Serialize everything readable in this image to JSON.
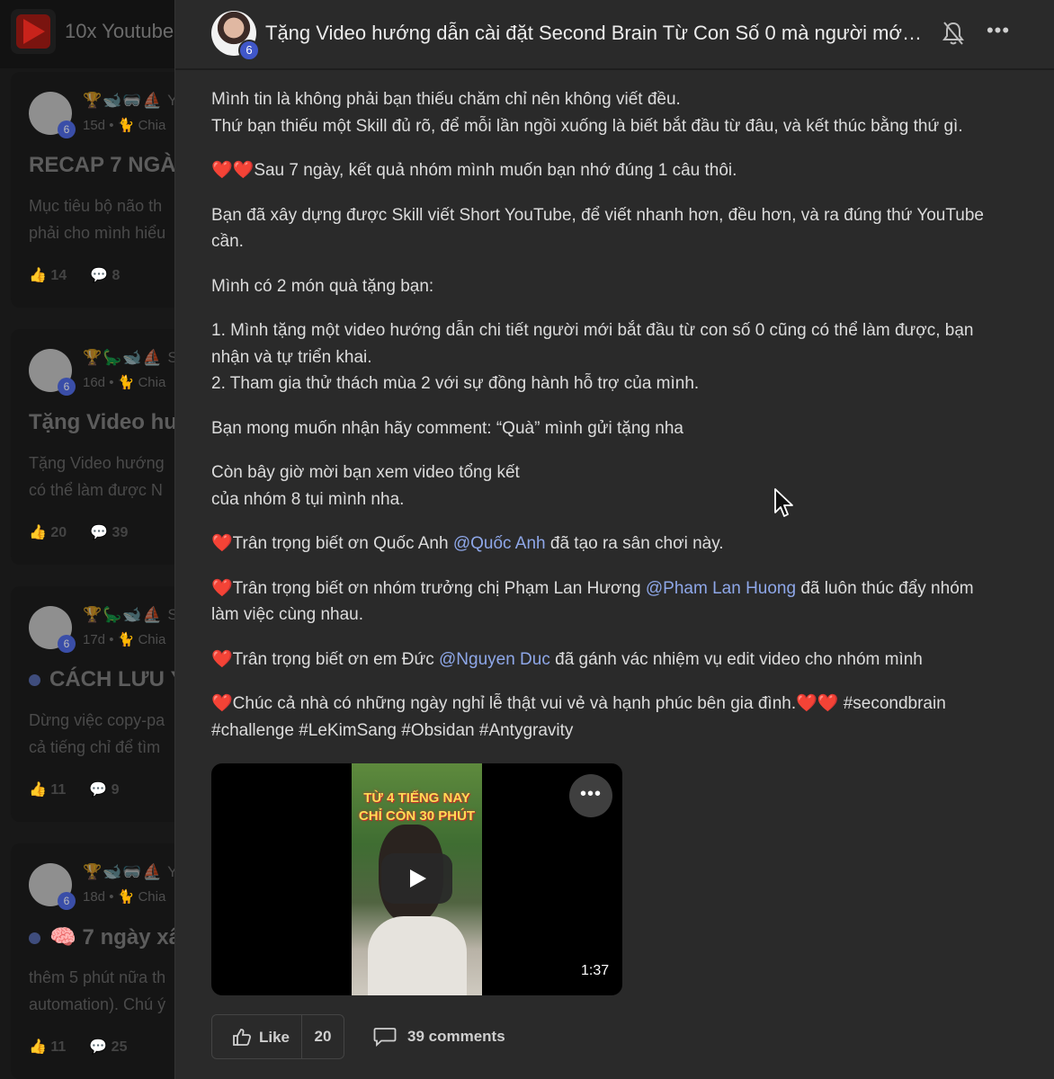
{
  "background": {
    "app_title": "10x Youtube",
    "cards": [
      {
        "emojis": "🏆🐋🥽⛵ Y",
        "meta": "15d • 🐈 Chia",
        "title": "RECAP 7 NGÀY",
        "excerpt": "Mục tiêu bộ não th\nphải cho mình hiểu",
        "likes": "14",
        "comments": "8",
        "dot": false
      },
      {
        "emojis": "🏆🦕🐋⛵ S",
        "meta": "16d • 🐈 Chia",
        "title": "Tặng Video hư",
        "excerpt": "Tặng Video hướng\ncó thể làm được N",
        "likes": "20",
        "comments": "39",
        "dot": false
      },
      {
        "emojis": "🏆🦕🐋⛵ S",
        "meta": "17d • 🐈 Chia",
        "title": "CÁCH LƯU Ý",
        "excerpt": "Dừng việc copy-pa\ncả tiếng chỉ để tìm",
        "likes": "11",
        "comments": "9",
        "dot": true
      },
      {
        "emojis": "🏆🐋🥽⛵ Y",
        "meta": "18d • 🐈 Chia",
        "title": "🧠 7 ngày xâ",
        "excerpt": "thêm 5 phút nữa th\nautomation). Chú ý",
        "likes": "11",
        "comments": "25",
        "dot": true
      }
    ],
    "level": "6"
  },
  "post": {
    "title": "Tặng Video hướng dẫn cài đặt Second Brain Từ Con Số 0 mà người mới ...",
    "author_level": "6",
    "paragraphs": {
      "p1_l1": "Mình tin là không phải bạn thiếu chăm chỉ nên không viết đều.",
      "p1_l2": "Thứ bạn thiếu một Skill đủ rõ, để mỗi lần ngồi xuống là biết bắt đầu từ đâu, và kết thúc bằng thứ gì.",
      "p2": "❤️❤️Sau 7 ngày, kết quả nhóm mình muốn bạn nhớ đúng 1 câu thôi.",
      "p3": "Bạn đã xây dựng được Skill viết Short YouTube, để viết nhanh hơn, đều hơn, và ra đúng thứ YouTube cần.",
      "p4": "Mình có 2 món quà tặng bạn:",
      "p5_l1": "1. Mình tặng một video hướng dẫn chi tiết người mới bắt đầu từ con số 0 cũng có thể làm được, bạn nhận và tự triển khai.",
      "p5_l2": "2. Tham gia thử thách mùa 2 với sự đồng hành hỗ trợ của mình.",
      "p6": "Bạn mong muốn nhận hãy comment: “Quà” mình gửi tặng nha",
      "p7_l1": "Còn bây giờ mời bạn xem video tổng kết",
      "p7_l2": "của nhóm 8 tụi mình nha.",
      "p8_a": "❤️Trân trọng biết ơn Quốc Anh ",
      "p8_mention": "@Quốc Anh",
      "p8_b": " đã tạo ra sân chơi này.",
      "p9_a": "❤️Trân trọng biết ơn nhóm trưởng chị Phạm Lan Hương ",
      "p9_mention": "@Pham Lan Huong",
      "p9_b": " đã luôn thúc đẩy nhóm làm việc cùng nhau.",
      "p10_a": "❤️Trân trọng biết ơn em Đức ",
      "p10_mention": "@Nguyen Duc",
      "p10_b": " đã gánh vác nhiệm vụ edit video cho nhóm mình",
      "p11": "❤️Chúc cả nhà có những ngày nghỉ lễ thật vui vẻ và hạnh phúc bên gia đình.❤️❤️ #secondbrain #challenge #LeKimSang #Obsidan #Antygravity"
    },
    "video": {
      "caption_line1": "TỪ 4 TIẾNG NAY",
      "caption_line2": "CHỈ CÒN 30 PHÚT",
      "duration": "1:37"
    },
    "actions": {
      "like_label": "Like",
      "like_count": "20",
      "comments_label": "39 comments"
    }
  },
  "colors": {
    "mention": "#8ea7e8",
    "modal_bg": "#2a2a2a",
    "level_badge": "#4057c9"
  }
}
